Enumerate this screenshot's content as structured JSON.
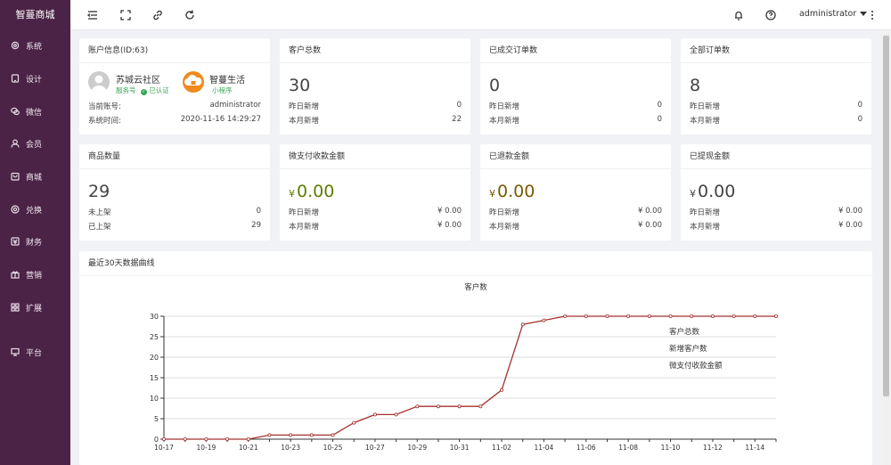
{
  "brand": "智蔓商城",
  "sidebar": {
    "items": [
      {
        "label": "系统",
        "icon": "gear-icon"
      },
      {
        "label": "设计",
        "icon": "tablet-icon"
      },
      {
        "label": "微信",
        "icon": "wechat-icon"
      },
      {
        "label": "会员",
        "icon": "user-icon"
      },
      {
        "label": "商城",
        "icon": "shop-icon"
      },
      {
        "label": "兑换",
        "icon": "exchange-icon"
      },
      {
        "label": "财务",
        "icon": "finance-icon"
      },
      {
        "label": "营销",
        "icon": "gift-icon"
      },
      {
        "label": "扩展",
        "icon": "grid-icon"
      },
      {
        "label": "平台",
        "icon": "monitor-icon"
      }
    ]
  },
  "topbar": {
    "icons": [
      "menu-toggle-icon",
      "fullscreen-icon",
      "link-icon",
      "refresh-icon",
      "bell-icon",
      "help-icon",
      "more-icon"
    ],
    "user": "administrator"
  },
  "account": {
    "title": "账户信息(ID:63)",
    "org_name": "苏城云社区",
    "org_type": "服务号",
    "org_verified": "已认证",
    "app_name": "智蔓生活",
    "app_type": "小程序",
    "current_account_label": "当前账号:",
    "current_account_value": "administrator",
    "system_time_label": "系统时间:",
    "system_time_value": "2020-11-16 14:29:27"
  },
  "stats": [
    {
      "title": "客户总数",
      "value": "30",
      "rows": [
        {
          "label": "昨日新增",
          "value": "0"
        },
        {
          "label": "本月新增",
          "value": "22"
        }
      ]
    },
    {
      "title": "已成交订单数",
      "value": "0",
      "rows": [
        {
          "label": "昨日新增",
          "value": "0"
        },
        {
          "label": "本月新增",
          "value": "0"
        }
      ]
    },
    {
      "title": "全部订单数",
      "value": "8",
      "rows": [
        {
          "label": "昨日新增",
          "value": "0"
        },
        {
          "label": "本月新增",
          "value": "0"
        }
      ]
    },
    {
      "title": "商品数量",
      "value": "29",
      "rows": [
        {
          "label": "未上架",
          "value": "0"
        },
        {
          "label": "已上架",
          "value": "29"
        }
      ]
    },
    {
      "title": "微支付收款金额",
      "currency": "¥",
      "value": "0.00",
      "rows": [
        {
          "label": "昨日新增",
          "value": "¥ 0.00"
        },
        {
          "label": "本月新增",
          "value": "¥ 0.00"
        }
      ]
    },
    {
      "title": "已退款金额",
      "currency": "¥",
      "value": "0.00",
      "rows": [
        {
          "label": "昨日新增",
          "value": "¥ 0.00"
        },
        {
          "label": "本月新增",
          "value": "¥ 0.00"
        }
      ]
    },
    {
      "title": "已提现金额",
      "currency": "¥",
      "value": "0.00",
      "rows": [
        {
          "label": "昨日新增",
          "value": "¥ 0.00"
        },
        {
          "label": "本月新增",
          "value": "¥ 0.00"
        }
      ]
    }
  ],
  "chart_card_title": "最近30天数据曲线",
  "colors": {
    "sidebar_bg": "#4b2346",
    "line": "#a5322f",
    "money_green": "#5c7d00",
    "money_brown": "#7a5a00"
  },
  "chart_data": {
    "type": "line",
    "title": "客户数",
    "x": [
      "10-17",
      "10-18",
      "10-19",
      "10-20",
      "10-21",
      "10-22",
      "10-23",
      "10-24",
      "10-25",
      "10-26",
      "10-27",
      "10-28",
      "10-29",
      "10-30",
      "10-31",
      "11-01",
      "11-02",
      "11-03",
      "11-04",
      "11-05",
      "11-06",
      "11-07",
      "11-08",
      "11-09",
      "11-10",
      "11-11",
      "11-12",
      "11-13",
      "11-14",
      "11-15"
    ],
    "x_tick_labels": [
      "10-17",
      "10-19",
      "10-21",
      "10-23",
      "10-25",
      "10-27",
      "10-29",
      "10-31",
      "11-02",
      "11-04",
      "11-06",
      "11-08",
      "11-10",
      "11-12",
      "11-14"
    ],
    "series": [
      {
        "name": "客户总数",
        "values": [
          0,
          0,
          0,
          0,
          0,
          1,
          1,
          1,
          1,
          4,
          6,
          6,
          8,
          8,
          8,
          8,
          12,
          28,
          29,
          30,
          30,
          30,
          30,
          30,
          30,
          30,
          30,
          30,
          30,
          30
        ]
      }
    ],
    "legend": [
      "客户总数",
      "新增客户数",
      "微支付收款金额"
    ],
    "ylim": [
      0,
      30
    ],
    "yticks": [
      0,
      5,
      10,
      15,
      20,
      25,
      30
    ],
    "grid": true,
    "legend_position": "right"
  }
}
